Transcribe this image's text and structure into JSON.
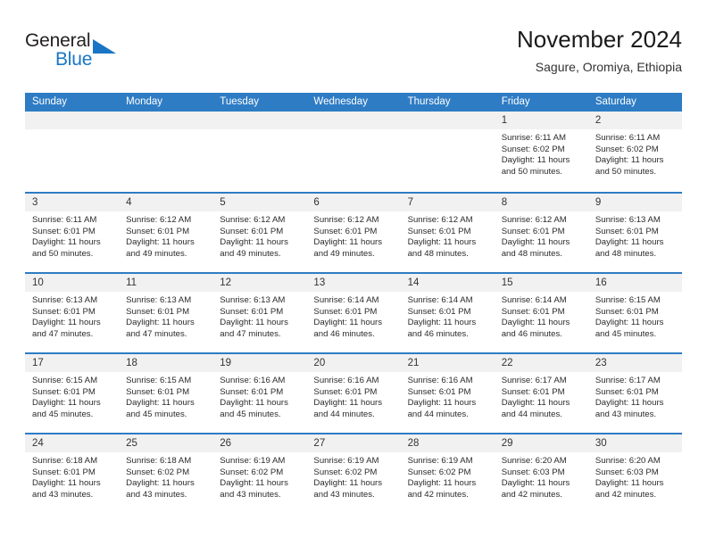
{
  "brand": {
    "word1": "General",
    "word2": "Blue",
    "triangle_icon": "brand-triangle-icon",
    "accent_color": "#1a76c4"
  },
  "header": {
    "title": "November 2024",
    "subtitle": "Sagure, Oromiya, Ethiopia"
  },
  "calendar": {
    "header_color": "#2e7cc4",
    "daynum_band_color": "#f1f1f1",
    "weekdays": [
      "Sunday",
      "Monday",
      "Tuesday",
      "Wednesday",
      "Thursday",
      "Friday",
      "Saturday"
    ],
    "weeks": [
      [
        {
          "day": "",
          "empty": true
        },
        {
          "day": "",
          "empty": true
        },
        {
          "day": "",
          "empty": true
        },
        {
          "day": "",
          "empty": true
        },
        {
          "day": "",
          "empty": true
        },
        {
          "day": "1",
          "sunrise": "Sunrise: 6:11 AM",
          "sunset": "Sunset: 6:02 PM",
          "daylight": "Daylight: 11 hours and 50 minutes."
        },
        {
          "day": "2",
          "sunrise": "Sunrise: 6:11 AM",
          "sunset": "Sunset: 6:02 PM",
          "daylight": "Daylight: 11 hours and 50 minutes."
        }
      ],
      [
        {
          "day": "3",
          "sunrise": "Sunrise: 6:11 AM",
          "sunset": "Sunset: 6:01 PM",
          "daylight": "Daylight: 11 hours and 50 minutes."
        },
        {
          "day": "4",
          "sunrise": "Sunrise: 6:12 AM",
          "sunset": "Sunset: 6:01 PM",
          "daylight": "Daylight: 11 hours and 49 minutes."
        },
        {
          "day": "5",
          "sunrise": "Sunrise: 6:12 AM",
          "sunset": "Sunset: 6:01 PM",
          "daylight": "Daylight: 11 hours and 49 minutes."
        },
        {
          "day": "6",
          "sunrise": "Sunrise: 6:12 AM",
          "sunset": "Sunset: 6:01 PM",
          "daylight": "Daylight: 11 hours and 49 minutes."
        },
        {
          "day": "7",
          "sunrise": "Sunrise: 6:12 AM",
          "sunset": "Sunset: 6:01 PM",
          "daylight": "Daylight: 11 hours and 48 minutes."
        },
        {
          "day": "8",
          "sunrise": "Sunrise: 6:12 AM",
          "sunset": "Sunset: 6:01 PM",
          "daylight": "Daylight: 11 hours and 48 minutes."
        },
        {
          "day": "9",
          "sunrise": "Sunrise: 6:13 AM",
          "sunset": "Sunset: 6:01 PM",
          "daylight": "Daylight: 11 hours and 48 minutes."
        }
      ],
      [
        {
          "day": "10",
          "sunrise": "Sunrise: 6:13 AM",
          "sunset": "Sunset: 6:01 PM",
          "daylight": "Daylight: 11 hours and 47 minutes."
        },
        {
          "day": "11",
          "sunrise": "Sunrise: 6:13 AM",
          "sunset": "Sunset: 6:01 PM",
          "daylight": "Daylight: 11 hours and 47 minutes."
        },
        {
          "day": "12",
          "sunrise": "Sunrise: 6:13 AM",
          "sunset": "Sunset: 6:01 PM",
          "daylight": "Daylight: 11 hours and 47 minutes."
        },
        {
          "day": "13",
          "sunrise": "Sunrise: 6:14 AM",
          "sunset": "Sunset: 6:01 PM",
          "daylight": "Daylight: 11 hours and 46 minutes."
        },
        {
          "day": "14",
          "sunrise": "Sunrise: 6:14 AM",
          "sunset": "Sunset: 6:01 PM",
          "daylight": "Daylight: 11 hours and 46 minutes."
        },
        {
          "day": "15",
          "sunrise": "Sunrise: 6:14 AM",
          "sunset": "Sunset: 6:01 PM",
          "daylight": "Daylight: 11 hours and 46 minutes."
        },
        {
          "day": "16",
          "sunrise": "Sunrise: 6:15 AM",
          "sunset": "Sunset: 6:01 PM",
          "daylight": "Daylight: 11 hours and 45 minutes."
        }
      ],
      [
        {
          "day": "17",
          "sunrise": "Sunrise: 6:15 AM",
          "sunset": "Sunset: 6:01 PM",
          "daylight": "Daylight: 11 hours and 45 minutes."
        },
        {
          "day": "18",
          "sunrise": "Sunrise: 6:15 AM",
          "sunset": "Sunset: 6:01 PM",
          "daylight": "Daylight: 11 hours and 45 minutes."
        },
        {
          "day": "19",
          "sunrise": "Sunrise: 6:16 AM",
          "sunset": "Sunset: 6:01 PM",
          "daylight": "Daylight: 11 hours and 45 minutes."
        },
        {
          "day": "20",
          "sunrise": "Sunrise: 6:16 AM",
          "sunset": "Sunset: 6:01 PM",
          "daylight": "Daylight: 11 hours and 44 minutes."
        },
        {
          "day": "21",
          "sunrise": "Sunrise: 6:16 AM",
          "sunset": "Sunset: 6:01 PM",
          "daylight": "Daylight: 11 hours and 44 minutes."
        },
        {
          "day": "22",
          "sunrise": "Sunrise: 6:17 AM",
          "sunset": "Sunset: 6:01 PM",
          "daylight": "Daylight: 11 hours and 44 minutes."
        },
        {
          "day": "23",
          "sunrise": "Sunrise: 6:17 AM",
          "sunset": "Sunset: 6:01 PM",
          "daylight": "Daylight: 11 hours and 43 minutes."
        }
      ],
      [
        {
          "day": "24",
          "sunrise": "Sunrise: 6:18 AM",
          "sunset": "Sunset: 6:01 PM",
          "daylight": "Daylight: 11 hours and 43 minutes."
        },
        {
          "day": "25",
          "sunrise": "Sunrise: 6:18 AM",
          "sunset": "Sunset: 6:02 PM",
          "daylight": "Daylight: 11 hours and 43 minutes."
        },
        {
          "day": "26",
          "sunrise": "Sunrise: 6:19 AM",
          "sunset": "Sunset: 6:02 PM",
          "daylight": "Daylight: 11 hours and 43 minutes."
        },
        {
          "day": "27",
          "sunrise": "Sunrise: 6:19 AM",
          "sunset": "Sunset: 6:02 PM",
          "daylight": "Daylight: 11 hours and 43 minutes."
        },
        {
          "day": "28",
          "sunrise": "Sunrise: 6:19 AM",
          "sunset": "Sunset: 6:02 PM",
          "daylight": "Daylight: 11 hours and 42 minutes."
        },
        {
          "day": "29",
          "sunrise": "Sunrise: 6:20 AM",
          "sunset": "Sunset: 6:03 PM",
          "daylight": "Daylight: 11 hours and 42 minutes."
        },
        {
          "day": "30",
          "sunrise": "Sunrise: 6:20 AM",
          "sunset": "Sunset: 6:03 PM",
          "daylight": "Daylight: 11 hours and 42 minutes."
        }
      ]
    ]
  }
}
